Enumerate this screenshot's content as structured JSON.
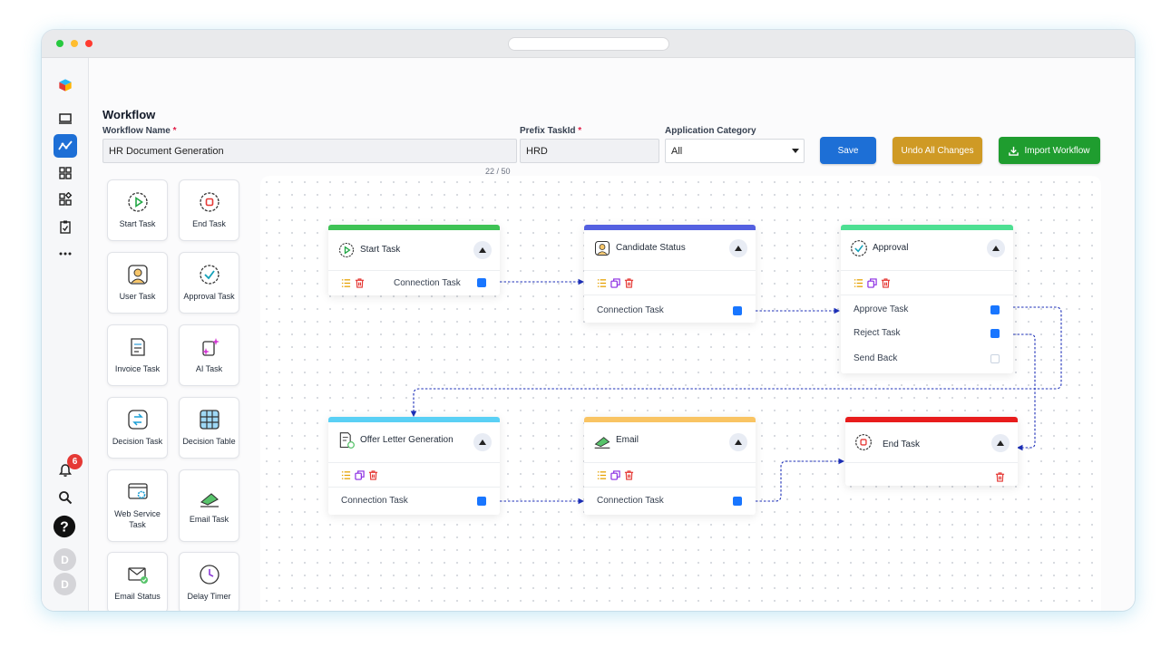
{
  "page": {
    "title": "Workflow"
  },
  "browser": {
    "traffic_lights": [
      "#27c93f",
      "#ffbd2e",
      "#ff3b30"
    ]
  },
  "sidebar": {
    "items": [
      "logo-icon",
      "monitor-icon",
      "workflow-icon",
      "dashboard-icon",
      "widgets-icon",
      "clipboard-icon",
      "more-icon"
    ],
    "active": "workflow-icon",
    "notifications_count": "6",
    "avatars": [
      "D",
      "D"
    ]
  },
  "form": {
    "workflow_name_label": "Workflow Name",
    "workflow_name_value": "HR Document Generation",
    "counter": "22 / 50",
    "prefix_label": "Prefix TaskId",
    "prefix_value": "HRD",
    "category_label": "Application Category",
    "category_value": "All",
    "required_mark": "*"
  },
  "toolbar": {
    "save_label": "Save",
    "undo_label": "Undo All Changes",
    "import_label": "Import Workflow"
  },
  "colors": {
    "save": "#1d6fd6",
    "undo": "#cf9a25",
    "import": "#1f9d2f"
  },
  "palette": [
    {
      "label": "Start Task",
      "icon": "play-circle-icon"
    },
    {
      "label": "End Task",
      "icon": "stop-circle-icon"
    },
    {
      "label": "User Task",
      "icon": "user-icon"
    },
    {
      "label": "Approval Task",
      "icon": "check-circle-icon"
    },
    {
      "label": "Invoice Task",
      "icon": "invoice-icon"
    },
    {
      "label": "AI Task",
      "icon": "sparkle-icon"
    },
    {
      "label": "Decision Task",
      "icon": "swap-icon"
    },
    {
      "label": "Decision Table",
      "icon": "grid-icon"
    },
    {
      "label": "Web Service Task",
      "icon": "web-service-icon"
    },
    {
      "label": "Email Task",
      "icon": "paper-plane-icon"
    },
    {
      "label": "Email Status",
      "icon": "mail-check-icon"
    },
    {
      "label": "Delay Timer",
      "icon": "clock-icon"
    }
  ],
  "nodes": {
    "start": {
      "title": "Start Task",
      "ports": [
        "Connection Task"
      ],
      "color": "#3ec255"
    },
    "candidate": {
      "title": "Candidate Status",
      "ports": [
        "Connection Task"
      ],
      "color": "#5460e0"
    },
    "approval": {
      "title": "Approval",
      "ports": [
        "Approve Task",
        "Reject Task",
        "Send Back"
      ],
      "color": "#4ddf92"
    },
    "offer": {
      "title": "Offer Letter Generation",
      "ports": [
        "Connection Task"
      ],
      "color": "#5ad0f5"
    },
    "email": {
      "title": "Email",
      "ports": [
        "Connection Task"
      ],
      "color": "#f9c463"
    },
    "end": {
      "title": "End Task",
      "ports": [],
      "color": "#e81c1c"
    }
  }
}
